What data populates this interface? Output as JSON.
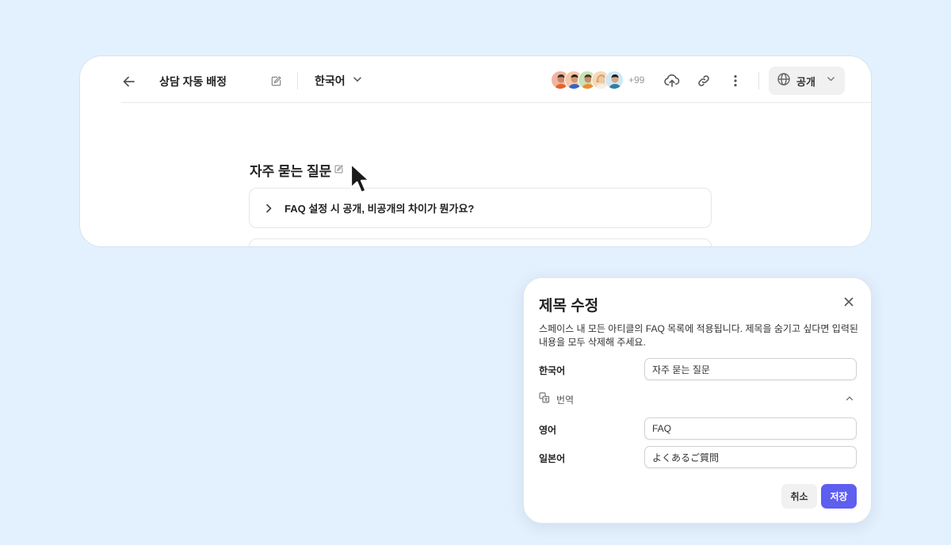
{
  "header": {
    "page_title": "상담 자동 배정",
    "language": "한국어",
    "collaborators_extra": "+99",
    "visibility": "공개"
  },
  "avatars": [
    {
      "icon": "avatar-person-1",
      "color": "#f1b3a0"
    },
    {
      "icon": "avatar-person-2",
      "color": "#f7c8a8"
    },
    {
      "icon": "avatar-person-3",
      "color": "#c8e2b8"
    },
    {
      "icon": "avatar-person-4",
      "color": "#f6d9b8"
    },
    {
      "icon": "avatar-person-5",
      "color": "#cfe8f7"
    }
  ],
  "content": {
    "faq_heading": "자주 묻는 질문",
    "faq_items": [
      {
        "question": "FAQ 설정 시 공개, 비공개의 차이가 뭔가요?"
      }
    ]
  },
  "modal": {
    "title": "제목 수정",
    "description": "스페이스 내 모든 아티클의 FAQ 목록에 적용됩니다. 제목을 숨기고 싶다면 입력된 내용을 모두 삭제해 주세요.",
    "korean_label": "한국어",
    "korean_value": "자주 묻는 질문",
    "translation_label": "번역",
    "english_label": "영어",
    "english_value": "FAQ",
    "japanese_label": "일본어",
    "japanese_value": "よくあるご質問",
    "cancel_label": "취소",
    "save_label": "저장"
  },
  "colors": {
    "background": "#e3f0fd",
    "primary": "#5e5ef0"
  }
}
